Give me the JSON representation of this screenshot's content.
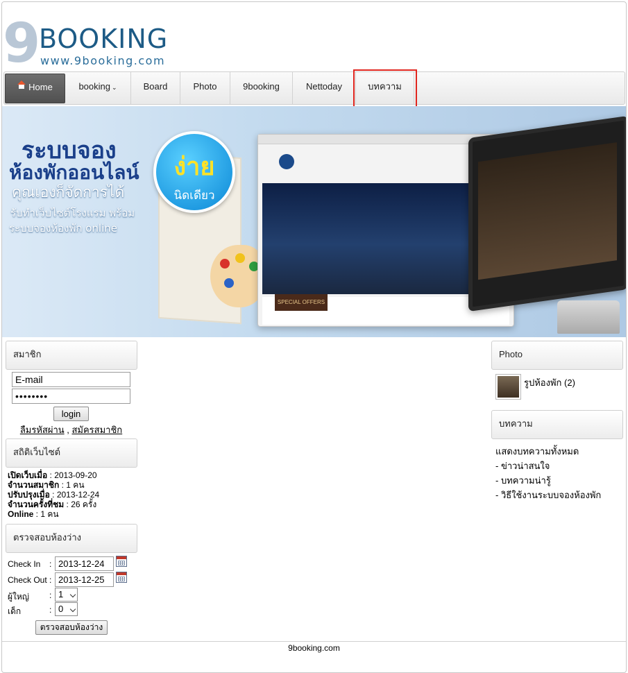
{
  "logo": {
    "digit": "9",
    "word": "BOOKING",
    "url": "www.9booking.com"
  },
  "nav": {
    "items": [
      {
        "label": "Home"
      },
      {
        "label": "booking"
      },
      {
        "label": "Board"
      },
      {
        "label": "Photo"
      },
      {
        "label": "9booking"
      },
      {
        "label": "Nettoday"
      },
      {
        "label": "บทความ"
      }
    ],
    "highlight_color": "#e0261f"
  },
  "banner": {
    "line1": "ระบบจอง",
    "line2": "ห้องพักออนไลน์",
    "line3": "คุณเองก็จัดการได้",
    "line4": "รับทำเว็บไซต์โรงแรม พร้อม",
    "line5": "ระบบจองห้องพัก online",
    "badge_big": "ง่าย",
    "badge_small": "นิดเดียว",
    "site_offer": "SPECIAL OFFERS"
  },
  "member": {
    "heading": "สมาชิก",
    "email_value": "E-mail",
    "password_value": "••••••••",
    "login_label": "login",
    "forgot_label": "ลืมรหัสผ่าน",
    "separator": " , ",
    "register_label": "สมัครสมาชิก"
  },
  "stats": {
    "heading": "สถิติเว็บไซต์",
    "rows": [
      {
        "label": "เปิดเว็บเมื่อ",
        "value": " : 2013-09-20"
      },
      {
        "label": "จำนวนสมาชิก",
        "value": " : 1 คน"
      },
      {
        "label": "ปรับปรุงเมื่อ",
        "value": " : 2013-12-24"
      },
      {
        "label": "จำนวนครั้งที่ชม",
        "value": " : 26 ครั้ง"
      },
      {
        "label": "Online",
        "value": " : 1 คน"
      }
    ]
  },
  "availability": {
    "heading": "ตรวจสอบห้องว่าง",
    "checkin_label": "Check In",
    "checkin_value": "2013-12-24",
    "checkout_label": "Check Out",
    "checkout_value": "2013-12-25",
    "adults_label": "ผู้ใหญ่",
    "adults_value": "1",
    "children_label": "เด็ก",
    "children_value": "0",
    "colon": ":",
    "submit_label": "ตรวจสอบห้องว่าง"
  },
  "photo": {
    "heading": "Photo",
    "album_label": "รูปห้องพัก (2)"
  },
  "articles": {
    "heading": "บทความ",
    "show_all": "แสดงบทความทั้งหมด",
    "items": [
      "- ข่าวน่าสนใจ",
      "- บทความน่ารู้",
      "- วิธีใช้งานระบบจองห้องพัก"
    ]
  },
  "footer": {
    "text": "9booking.com"
  }
}
